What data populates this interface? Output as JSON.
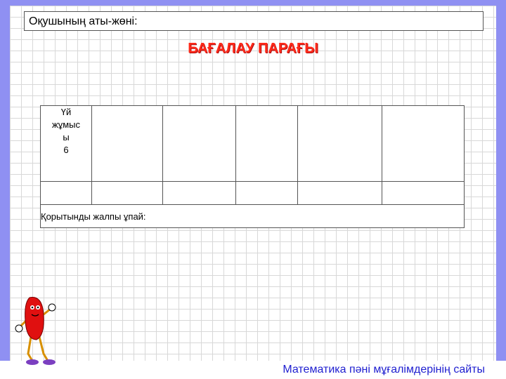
{
  "student_label": "Оқушының аты-жөні:",
  "title": "БАҒАЛАУ ПАРАҒЫ",
  "table": {
    "first_cell": [
      "Үй",
      "жұмыс",
      "ы",
      "6"
    ],
    "total_label": "Қорытынды жалпы ұпай:"
  },
  "footer": "Математика пәні мұғалімдерінің сайты",
  "colors": {
    "background": "#8f90f2",
    "title": "#ff2a1a",
    "footer_text": "#2020d0"
  },
  "icons": [
    "cartoon-mascot-icon"
  ]
}
